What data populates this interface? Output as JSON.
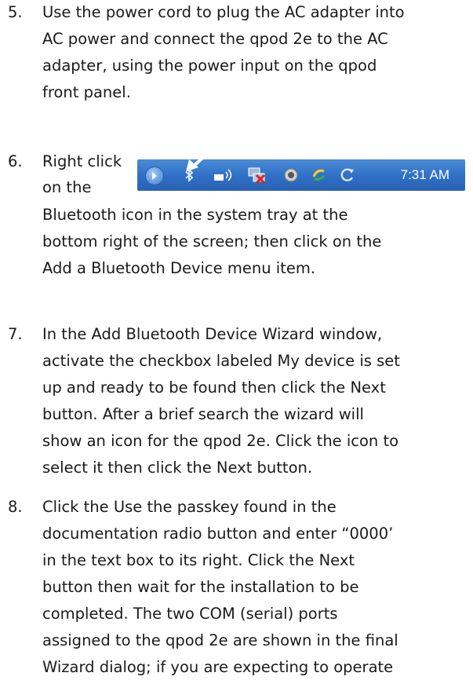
{
  "steps": [
    {
      "number": "5.",
      "lines": [
        "Use the power cord to plug the AC adapter into",
        "AC power and connect the qpod 2e to the AC",
        "adapter, using the power input on the qpod",
        "front panel."
      ]
    },
    {
      "number": "6.",
      "lines": [
        "Right click",
        "on the",
        "Bluetooth icon in the system tray at the",
        "bottom right of the screen; then click on the",
        "Add a Bluetooth Device menu item."
      ]
    },
    {
      "number": "7.",
      "lines": [
        "In the Add Bluetooth Device Wizard window,",
        "activate the checkbox labeled My device is set",
        "up and ready to be found then click the Next",
        "button.  After a brief search the wizard will",
        "show an icon for the qpod 2e.  Click the icon to",
        "select it then click the Next button."
      ]
    },
    {
      "number": "8.",
      "lines": [
        "Click the Use the passkey found in the",
        "documentation radio button and enter “0000’",
        "in the text box to its right.  Click the Next",
        "button then wait for the installation to be",
        "completed.  The two COM  (serial) ports",
        "assigned to the qpod 2e are shown in the final",
        "Wizard dialog; if you are expecting to operate"
      ]
    }
  ],
  "tray": {
    "clock": "7:31 AM",
    "background": "#2f6fc4",
    "icons": [
      "expand-arrow-icon",
      "bluetooth-icon",
      "wireless-network-icon",
      "network-error-icon",
      "security-shield-icon",
      "update-icon",
      "refresh-icon"
    ]
  }
}
